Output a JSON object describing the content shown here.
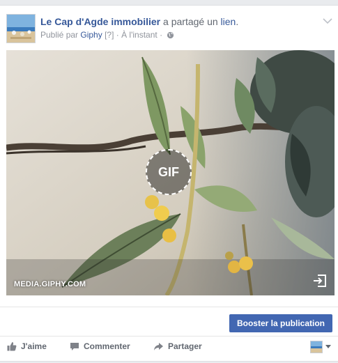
{
  "post": {
    "page_name": "Le Cap d'Agde immobilier",
    "verb": " a partagé un ",
    "link_word": "lien",
    "period": ".",
    "published_by": "Publié par ",
    "publisher": "Giphy",
    "help": " [?] · ",
    "time": "À l'instant",
    "sep": " · ",
    "privacy_icon": "globe-icon",
    "options_icon": "chevron-down-icon"
  },
  "media": {
    "badge": "GIF",
    "source": "MEDIA.GIPHY.COM",
    "share_icon": "share-arrow-icon"
  },
  "boost": {
    "label": "Booster la publication",
    "color": "#4267b2"
  },
  "actions": {
    "like": "J'aime",
    "comment": "Commenter",
    "share": "Partager",
    "icons": [
      "thumbs-up-icon",
      "comment-icon",
      "share-icon"
    ]
  },
  "colors": {
    "link": "#365899",
    "meta": "#90949c",
    "action": "#616770"
  }
}
